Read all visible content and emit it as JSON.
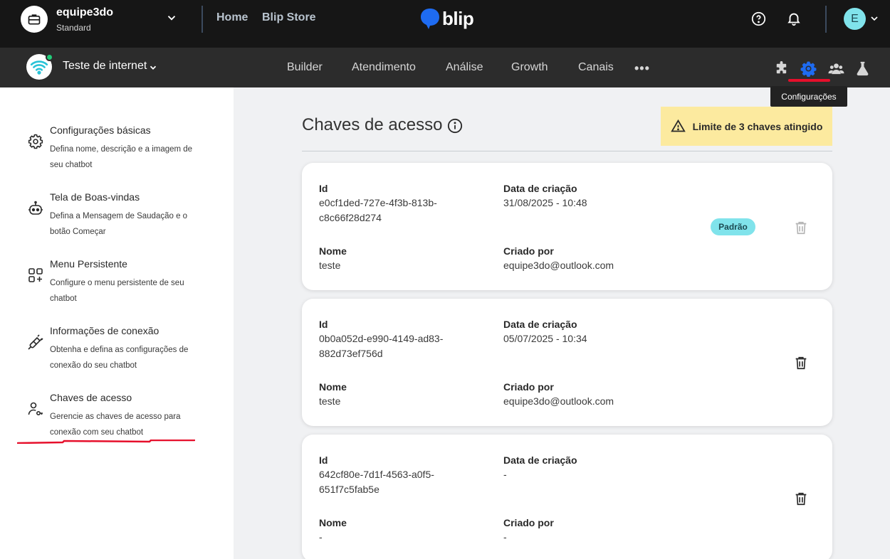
{
  "topbar": {
    "workspace_name": "equipe3do",
    "workspace_plan": "Standard",
    "links": [
      "Home",
      "Blip Store"
    ],
    "logo_text": "blip",
    "avatar_letter": "E"
  },
  "subbar": {
    "bot_name": "Teste de internet",
    "nav": [
      "Builder",
      "Atendimento",
      "Análise",
      "Growth",
      "Canais"
    ],
    "more": "•••",
    "tooltip": "Configurações"
  },
  "sidebar": {
    "items": [
      {
        "title": "Configurações básicas",
        "desc": "Defina nome, descrição e a imagem de seu chatbot",
        "icon": "gear-icon"
      },
      {
        "title": "Tela de Boas-vindas",
        "desc": "Defina a Mensagem de Saudação e o botão Começar",
        "icon": "robot-icon"
      },
      {
        "title": "Menu Persistente",
        "desc": "Configure o menu persistente de seu chatbot",
        "icon": "grid-plus-icon"
      },
      {
        "title": "Informações de conexão",
        "desc": "Obtenha e defina as configurações de conexão do seu chatbot",
        "icon": "plug-icon"
      },
      {
        "title": "Chaves de acesso",
        "desc": "Gerencie as chaves de acesso para conexão com seu chatbot",
        "icon": "user-key-icon"
      }
    ]
  },
  "main": {
    "title": "Chaves de acesso",
    "limit_alert": "Limite de 3 chaves atingido",
    "labels": {
      "id": "Id",
      "created_at": "Data de criação",
      "name": "Nome",
      "created_by": "Criado por"
    },
    "keys": [
      {
        "id_line1": "e0cf1ded-727e-4f3b-813b-",
        "id_line2": "c8c66f28d274",
        "created_at": "31/08/2025 - 10:48",
        "name": "teste",
        "created_by": "equipe3do@outlook.com",
        "badge": "Padrão"
      },
      {
        "id_line1": "0b0a052d-e990-4149-ad83-",
        "id_line2": "882d73ef756d",
        "created_at": "05/07/2025 - 10:34",
        "name": "teste",
        "created_by": "equipe3do@outlook.com"
      },
      {
        "id_line1": "642cf80e-7d1f-4563-a0f5-",
        "id_line2": "651f7c5fab5e",
        "created_at": "-",
        "name": "-",
        "created_by": "-"
      }
    ]
  },
  "colors": {
    "topbar_bg": "#161616",
    "subbar_bg": "#2c2c2c",
    "accent_blue": "#1e6bf1",
    "highlight_red": "#e60f2b",
    "badge_cyan": "#80e3eb",
    "alert_yellow": "#fcea9f"
  }
}
